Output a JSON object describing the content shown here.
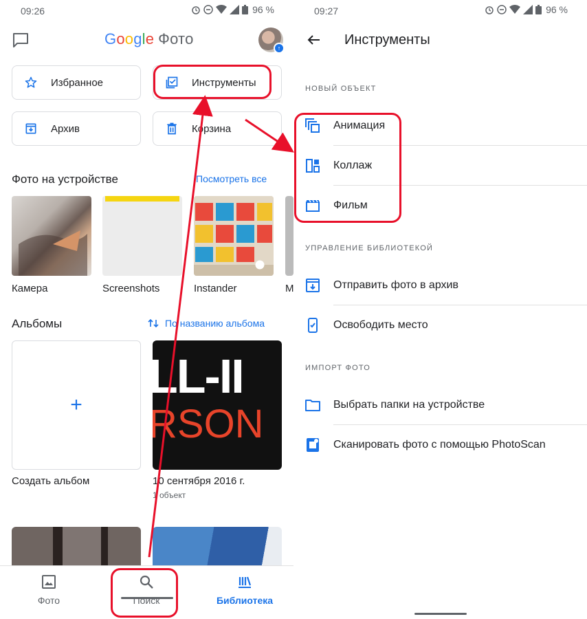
{
  "left": {
    "status": {
      "time": "09:26",
      "battery": "96 %"
    },
    "header": {
      "logo_letters": [
        "G",
        "o",
        "o",
        "g",
        "l",
        "e"
      ],
      "logo_suffix": "Фото"
    },
    "chips": {
      "favorites": "Избранное",
      "tools": "Инструменты",
      "archive": "Архив",
      "trash": "Корзина"
    },
    "device_photos": {
      "title": "Фото на устройстве",
      "link": "Посмотреть все",
      "folders": [
        "Камера",
        "Screenshots",
        "Instander",
        "M"
      ]
    },
    "albums": {
      "title": "Альбомы",
      "sort_link": "По названию альбома",
      "create_label": "Создать альбом",
      "plus": "+",
      "album_name": "10 сентября 2016 г.",
      "album_count": "1 объект",
      "poster_line1": "LL-II",
      "poster_line2": "RSON"
    },
    "nav": {
      "photos": "Фото",
      "search": "Поиск",
      "library": "Библиотека"
    }
  },
  "right": {
    "status": {
      "time": "09:27",
      "battery": "96 %"
    },
    "title": "Инструменты",
    "sections": {
      "new_object": "НОВЫЙ ОБЪЕКТ",
      "library_mgmt": "УПРАВЛЕНИЕ БИБЛИОТЕКОЙ",
      "import": "ИМПОРТ ФОТО"
    },
    "items": {
      "animation": "Анимация",
      "collage": "Коллаж",
      "movie": "Фильм",
      "archive": "Отправить фото в архив",
      "free_space": "Освободить место",
      "choose_folders": "Выбрать папки на устройстве",
      "photoscan": "Сканировать фото с помощью PhotoScan"
    }
  },
  "colors": {
    "accent": "#1a73e8",
    "highlight": "#e8102a",
    "icon": "#5f6368"
  },
  "icons": [
    "chat-icon",
    "star-icon",
    "tools-icon",
    "archive-icon",
    "trash-icon",
    "sort-icon",
    "search-icon",
    "library-icon",
    "back-arrow-icon",
    "animation-icon",
    "collage-icon",
    "movie-icon",
    "free-space-icon",
    "folder-icon",
    "photoscan-icon"
  ]
}
